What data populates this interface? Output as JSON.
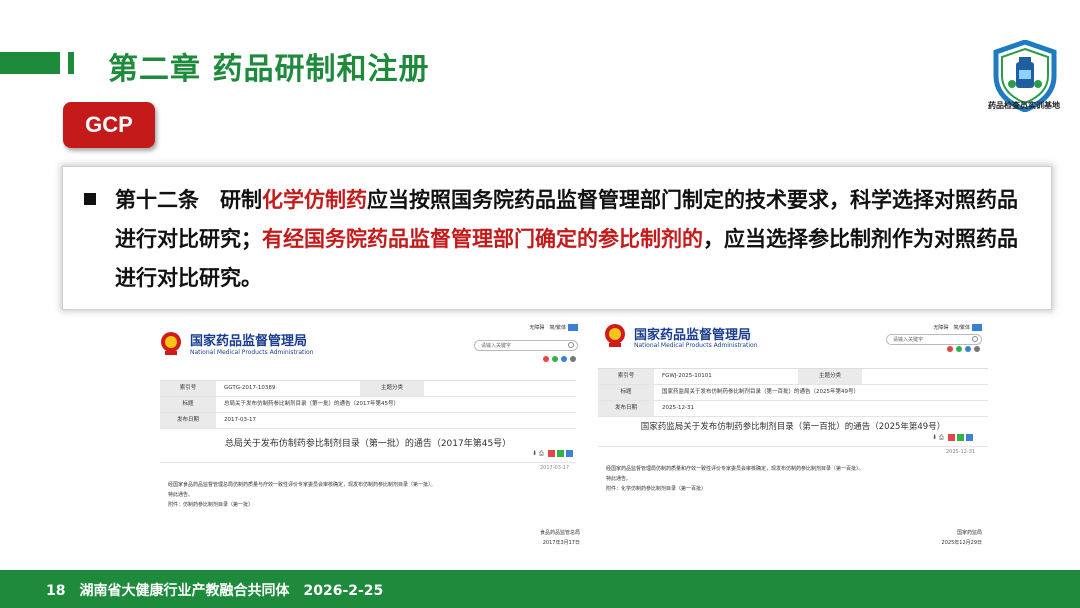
{
  "slide": {
    "title": "第二章  药品研制和注册",
    "logo_caption": "药品检查员实训基地",
    "badge": "GCP",
    "para": {
      "p1": "第十二条　研制",
      "p2": "化学仿制药",
      "p3": "应当按照国务院药品监督管理部门制定的技术要求，科学选择对照药品进行对比研究；",
      "p4": "有经国务院药品监督管理部门确定的参比制剂的",
      "p5": "，应当选择参比制剂作为对照药品进行对比研究。"
    },
    "footer": {
      "page": "18",
      "org": "湖南省大健康行业产教融合共同体",
      "date": "2026-2-25"
    }
  },
  "doc1": {
    "agency": "国家药品监督管理局",
    "agency_en": "National Medical Products Administration",
    "links": "无障碍　简/繁体",
    "links_btn": "EN",
    "search_placeholder": "请输入关键字",
    "rows": [
      {
        "k": "索引号",
        "v": "GGTG-2017-10389",
        "k2": "主题分类"
      },
      {
        "k": "标题",
        "v": "总局关于发布仿制药参比制剂目录（第一批）的通告（2017年第45号）"
      },
      {
        "k": "发布日期",
        "v": "2017-03-17"
      }
    ],
    "title": "总局关于发布仿制药参比制剂目录（第一批）的通告（2017年第45号）",
    "date_gray": "2017-03-17",
    "body1": "经国家食品药品监督管理总局仿制药质量与疗效一致性评价专家委员会审核确定，现发布仿制药参比制剂目录（第一批）。",
    "body2": "特此通告。",
    "body3": "附件：仿制药参比制剂目录（第一批）",
    "sign1": "食品药品监管总局",
    "sign2": "2017年3月17日"
  },
  "doc2": {
    "agency": "国家药品监督管理局",
    "agency_en": "National Medical Products Administration",
    "links": "无障碍　简/繁体",
    "links_btn": "EN",
    "search_placeholder": "请输入关键字",
    "rows": [
      {
        "k": "索引号",
        "v": "FGWJ-2025-10101",
        "k2": "主题分类"
      },
      {
        "k": "标题",
        "v": "国家药监局关于发布仿制药参比制剂目录（第一百批）的通告（2025年第49号）"
      },
      {
        "k": "发布日期",
        "v": "2025-12-31"
      }
    ],
    "title": "国家药监局关于发布仿制药参比制剂目录（第一百批）的通告（2025年第49号）",
    "date_gray": "2025-12-31",
    "body1": "经国家药品监督管理局仿制药质量和疗效一致性评价专家委员会审核确定，现发布仿制药参比制剂目录（第一百批）。",
    "body2": "特此通告。",
    "body3": "附件：化学仿制药参比制剂目录（第一百批）",
    "sign1": "国家药监局",
    "sign2": "2025年12月29日"
  },
  "colors": {
    "green": "#1e8a3c",
    "red": "#c41a1a",
    "agency_blue": "#1a3d8f"
  }
}
